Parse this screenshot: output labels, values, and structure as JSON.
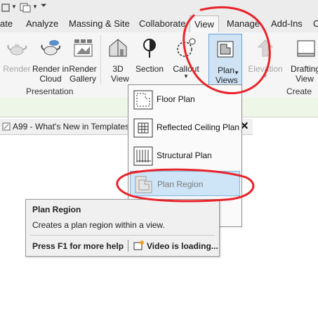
{
  "tabs": {
    "items": [
      {
        "label": "ate"
      },
      {
        "label": "Analyze"
      },
      {
        "label": "Massing & Site"
      },
      {
        "label": "Collaborate"
      },
      {
        "label": "View"
      },
      {
        "label": "Manage"
      },
      {
        "label": "Add-Ins"
      },
      {
        "label": "C"
      }
    ],
    "active": "View"
  },
  "ribbon": {
    "presentation": {
      "render": "Render",
      "render_cloud": "Render in Cloud",
      "render_gallery": "Render Gallery",
      "panel_label": "Presentation"
    },
    "create": {
      "view_3d": "3D View",
      "section": "Section",
      "callout": "Callout",
      "plan_views": "Plan Views",
      "elevation": "Elevation",
      "drafting": "Drafting View",
      "panel_label": "Create"
    }
  },
  "view_tab": {
    "label": "A99 - What's New in Templates",
    "close": "✕"
  },
  "dropdown": {
    "items": [
      {
        "label": "Floor Plan"
      },
      {
        "label": "Reflected Ceiling Plan"
      },
      {
        "label": "Structural Plan"
      },
      {
        "label": "Plan Region"
      }
    ]
  },
  "tooltip": {
    "title": "Plan Region",
    "description": "Creates a plan region within a view.",
    "help": "Press F1 for more help",
    "video": "Video is loading..."
  },
  "colors": {
    "accent": "#6aa3d8",
    "highlight": "#cde5f7",
    "annotation": "#e8232a"
  }
}
